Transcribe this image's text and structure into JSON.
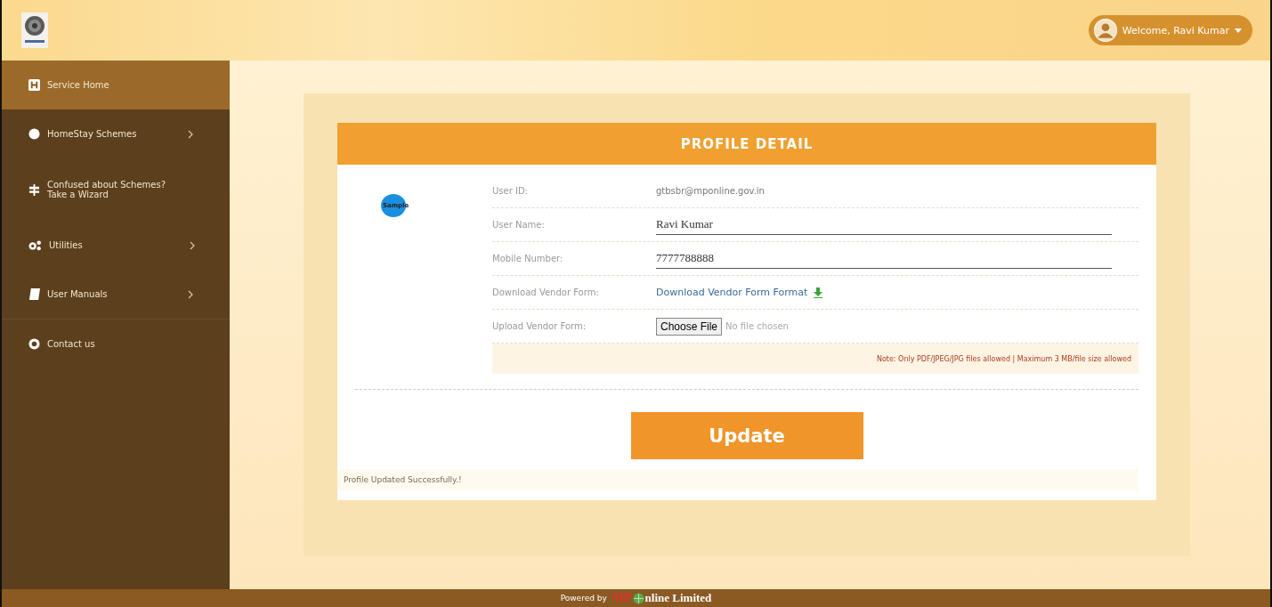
{
  "header": {
    "welcome": "Welcome, Ravi Kumar"
  },
  "sidebar": {
    "items": [
      {
        "kind": "home",
        "label": "Service Home",
        "selected": true,
        "expandable": false
      },
      {
        "kind": "dot",
        "label": "HomeStay Schemes",
        "selected": false,
        "expandable": true
      },
      {
        "kind": "signpost",
        "label": "Confused about Schemes? Take a Wizard",
        "selected": false,
        "expandable": false
      },
      {
        "kind": "gears",
        "label": "Utilities",
        "selected": false,
        "expandable": true
      },
      {
        "kind": "book",
        "label": "User Manuals",
        "selected": false,
        "expandable": true
      },
      {
        "kind": "support",
        "label": "Contact us",
        "selected": false,
        "expandable": false
      }
    ]
  },
  "profile": {
    "title": "PROFILE DETAIL",
    "photo_label": "Sample",
    "rows": [
      {
        "kind": "text",
        "label": "User ID:",
        "value": "gtbsbr@mponline.gov.in"
      },
      {
        "kind": "input",
        "label": "User Name:",
        "value": "Ravi Kumar"
      },
      {
        "kind": "input",
        "label": "Mobile Number:",
        "value": "7777788888"
      },
      {
        "kind": "link",
        "label": "Download Vendor Form:",
        "value": "Download Vendor Form Format"
      },
      {
        "kind": "file",
        "label": "Upload Vendor Form:",
        "button": "Choose File",
        "value": "No file chosen"
      }
    ],
    "note": "Note: Only PDF/JPEG/JPG files allowed | Maximum 3 MB/file size allowed",
    "button": "Update",
    "status": "Profile Updated Successfully.!"
  },
  "footer": {
    "powered_by": "Powered by",
    "logo_left": "MP",
    "logo_right": "nline Limited"
  }
}
